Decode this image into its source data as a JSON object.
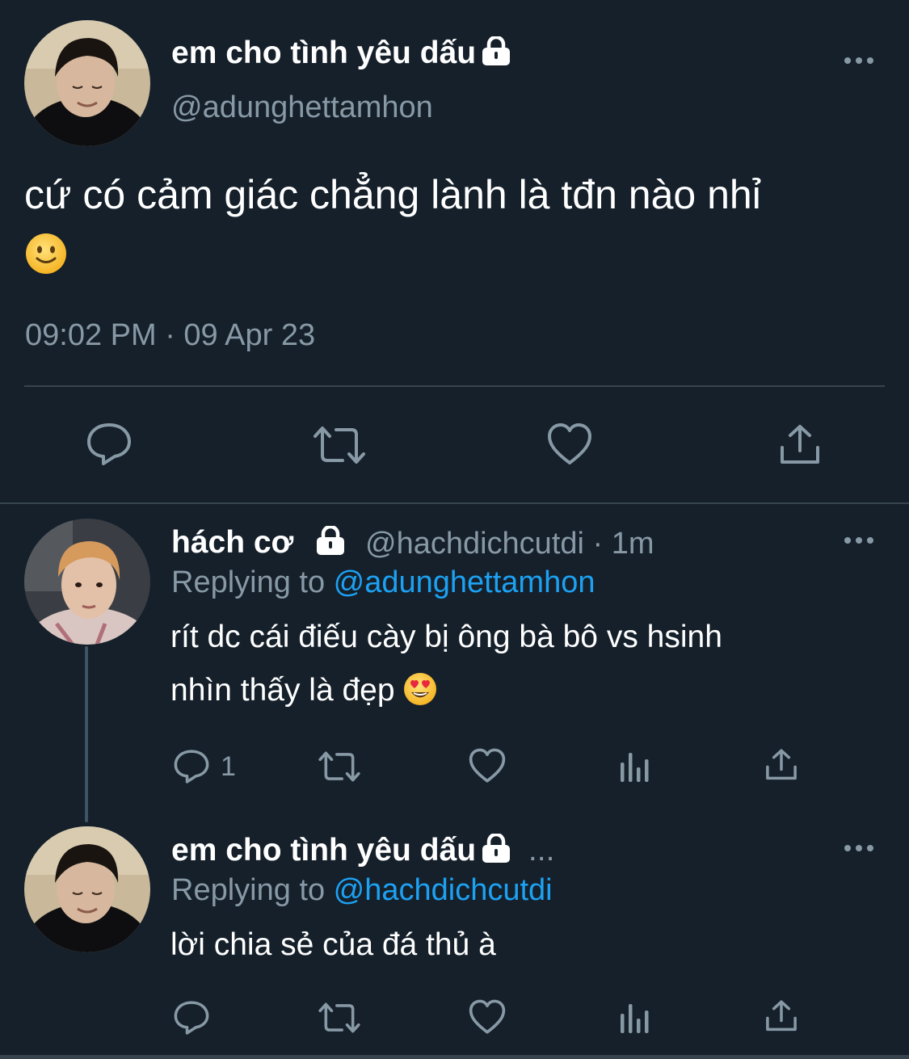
{
  "main_tweet": {
    "author_name": "em cho tình yêu dấu",
    "handle": "@adunghettamhon",
    "text": "cứ có cảm giác chẳng lành là tđn nào nhỉ",
    "emoji": "slightly-smiling-face",
    "timestamp": "09:02 PM · 09 Apr 23",
    "actions": [
      "reply",
      "retweet",
      "like",
      "share"
    ]
  },
  "reply_1": {
    "author_name": "hách cơ",
    "meta": "@hachdichcutdi · 1m",
    "replying_prefix": "Replying to ",
    "replying_handle": "@adunghettamhon",
    "text_line_1": "rít dc cái điếu cày bị ông bà bô vs hsinh",
    "text_line_2": "nhìn thấy là đẹp",
    "emoji": "heart-eyes-face",
    "reply_count": "1",
    "actions": [
      "reply",
      "retweet",
      "like",
      "analytics",
      "share"
    ]
  },
  "reply_2": {
    "author_name": "em cho tình yêu dấu",
    "name_ellipsis": "...",
    "replying_prefix": "Replying to ",
    "replying_handle": "@hachdichcutdi",
    "text": "lời chia sẻ của đá thủ à",
    "actions": [
      "reply",
      "retweet",
      "like",
      "analytics",
      "share"
    ]
  },
  "colors": {
    "background": "#15202b",
    "secondary_text": "#8899a6",
    "accent": "#1da1f2",
    "divider": "#38444d"
  }
}
